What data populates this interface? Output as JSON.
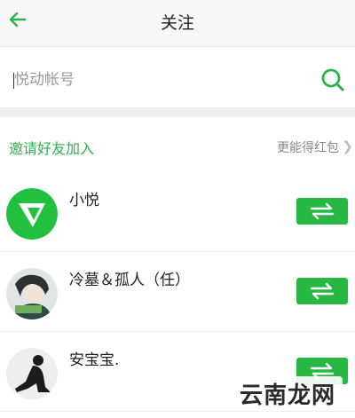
{
  "header": {
    "title": "关注"
  },
  "search": {
    "placeholder": "悦动帐号"
  },
  "invite": {
    "label": "邀请好友加入",
    "hint": "更能得红包"
  },
  "users": [
    {
      "name": "小悦",
      "avatar": "yuedong-logo-avatar"
    },
    {
      "name": "冷墓＆孤人（任）",
      "avatar": "anime-character-avatar"
    },
    {
      "name": "安宝宝.",
      "avatar": "silhouette-avatar"
    }
  ],
  "watermark": {
    "text": "云南龙网"
  },
  "colors": {
    "accent": "#27b844",
    "text_green": "#2ab34a",
    "hint": "#8a8a8a"
  }
}
